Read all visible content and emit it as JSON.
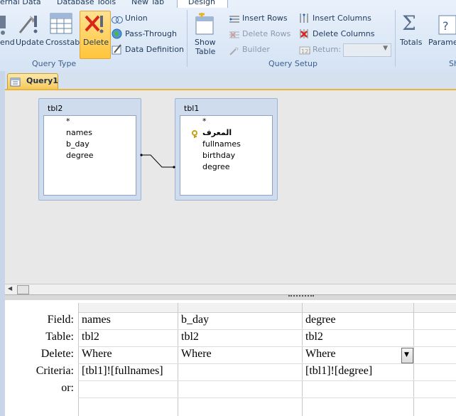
{
  "ribbon": {
    "tabs": [
      "ernal Data",
      "Database Tools",
      "New Tab",
      "Design"
    ],
    "buttons": {
      "append": "end",
      "update": "Update",
      "crosstab": "Crosstab",
      "delete": "Delete",
      "union": "Union",
      "pass_through": "Pass-Through",
      "data_definition": "Data Definition",
      "show_table_1": "Show",
      "show_table_2": "Table",
      "insert_rows": "Insert Rows",
      "delete_rows": "Delete Rows",
      "builder": "Builder",
      "insert_columns": "Insert Columns",
      "delete_columns": "Delete Columns",
      "return": "Return:",
      "totals": "Totals",
      "parameters": "Paramet"
    },
    "group_labels": {
      "query_type": "Query Type",
      "query_setup": "Query Setup",
      "show_hide": "Sh"
    }
  },
  "document_tab": "Query1",
  "tables": [
    {
      "name": "tbl2",
      "fields": [
        "*",
        "names",
        "b_day",
        "degree"
      ]
    },
    {
      "name": "tbl1",
      "fields": [
        "*",
        "المعرف",
        "fullnames",
        "birthday",
        "degree"
      ]
    }
  ],
  "grid": {
    "row_labels": [
      "Field:",
      "Table:",
      "Delete:",
      "Criteria:",
      "or:"
    ],
    "columns": [
      {
        "field": "names",
        "table": "tbl2",
        "delete": "Where",
        "criteria": "[tbl1]![fullnames]"
      },
      {
        "field": "b_day",
        "table": "tbl2",
        "delete": "Where",
        "criteria": ""
      },
      {
        "field": "degree",
        "table": "tbl2",
        "delete": "Where",
        "criteria": "[tbl1]![degree]"
      }
    ]
  }
}
